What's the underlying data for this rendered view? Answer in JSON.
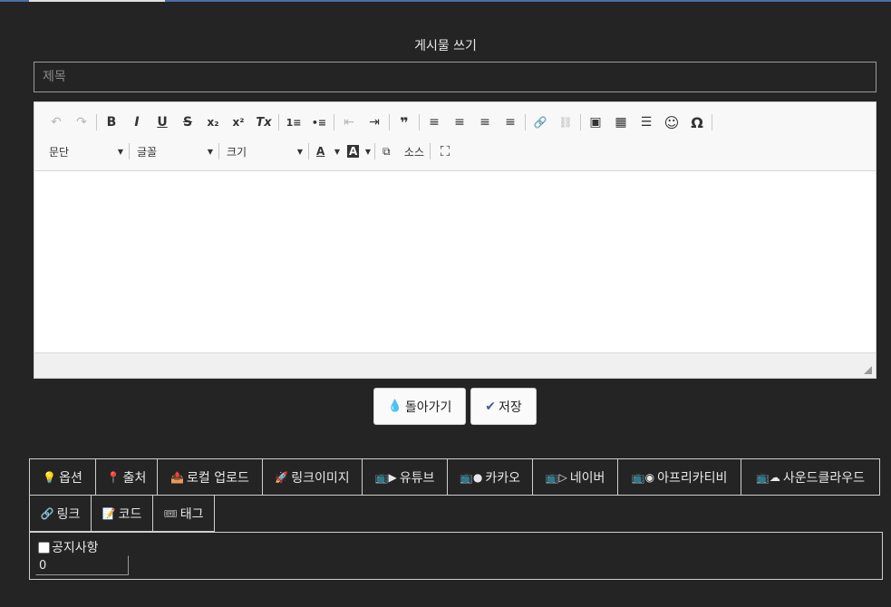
{
  "page": {
    "title": "게시물 쓰기"
  },
  "form": {
    "title_placeholder": "제목"
  },
  "toolbar": {
    "paragraph": "문단",
    "font": "글꼴",
    "size": "크기",
    "source": "소스",
    "icons": {
      "undo": "↶",
      "redo": "↷",
      "bold": "B",
      "italic": "I",
      "underline": "U",
      "strike": "S",
      "subscript": "x₂",
      "superscript": "x²",
      "clear_format": "Tx",
      "numbered_list": "1≡",
      "bullet_list": "•≡",
      "outdent": "⇤",
      "indent": "⇥",
      "quote": "❞",
      "align_left": "≡",
      "align_center": "≡",
      "align_right": "≡",
      "justify": "≡",
      "link": "🔗",
      "unlink": "⛓",
      "image": "▣",
      "table": "▦",
      "hr": "☰",
      "smiley": "☺",
      "special_char": "Ω",
      "text_color": "A",
      "bg_color": "A",
      "source_icon": "⧉",
      "maximize": "⛶"
    }
  },
  "actions": {
    "back": "돌아가기",
    "save": "저장"
  },
  "tabs": [
    {
      "icon": "💡",
      "label": "옵션"
    },
    {
      "icon": "📍",
      "label": "출처"
    },
    {
      "icon": "📤",
      "label": "로컬 업로드"
    },
    {
      "icon": "🚀",
      "label": "링크이미지"
    },
    {
      "icon": "📺▶",
      "label": "유튜브"
    },
    {
      "icon": "📺●",
      "label": "카카오"
    },
    {
      "icon": "📺▷",
      "label": "네이버"
    },
    {
      "icon": "📺◉",
      "label": "아프리카티비"
    },
    {
      "icon": "📺☁",
      "label": "사운드클라우드"
    },
    {
      "icon": "🔗",
      "label": "링크"
    },
    {
      "icon": "📝",
      "label": "코드"
    },
    {
      "icon": "🎟",
      "label": "태그"
    }
  ],
  "options": {
    "notice_label": "공지사항",
    "order_value": "0"
  },
  "colors": {
    "background": "#242424",
    "border": "#cfcfcf",
    "accent": "#4a6fa5"
  }
}
